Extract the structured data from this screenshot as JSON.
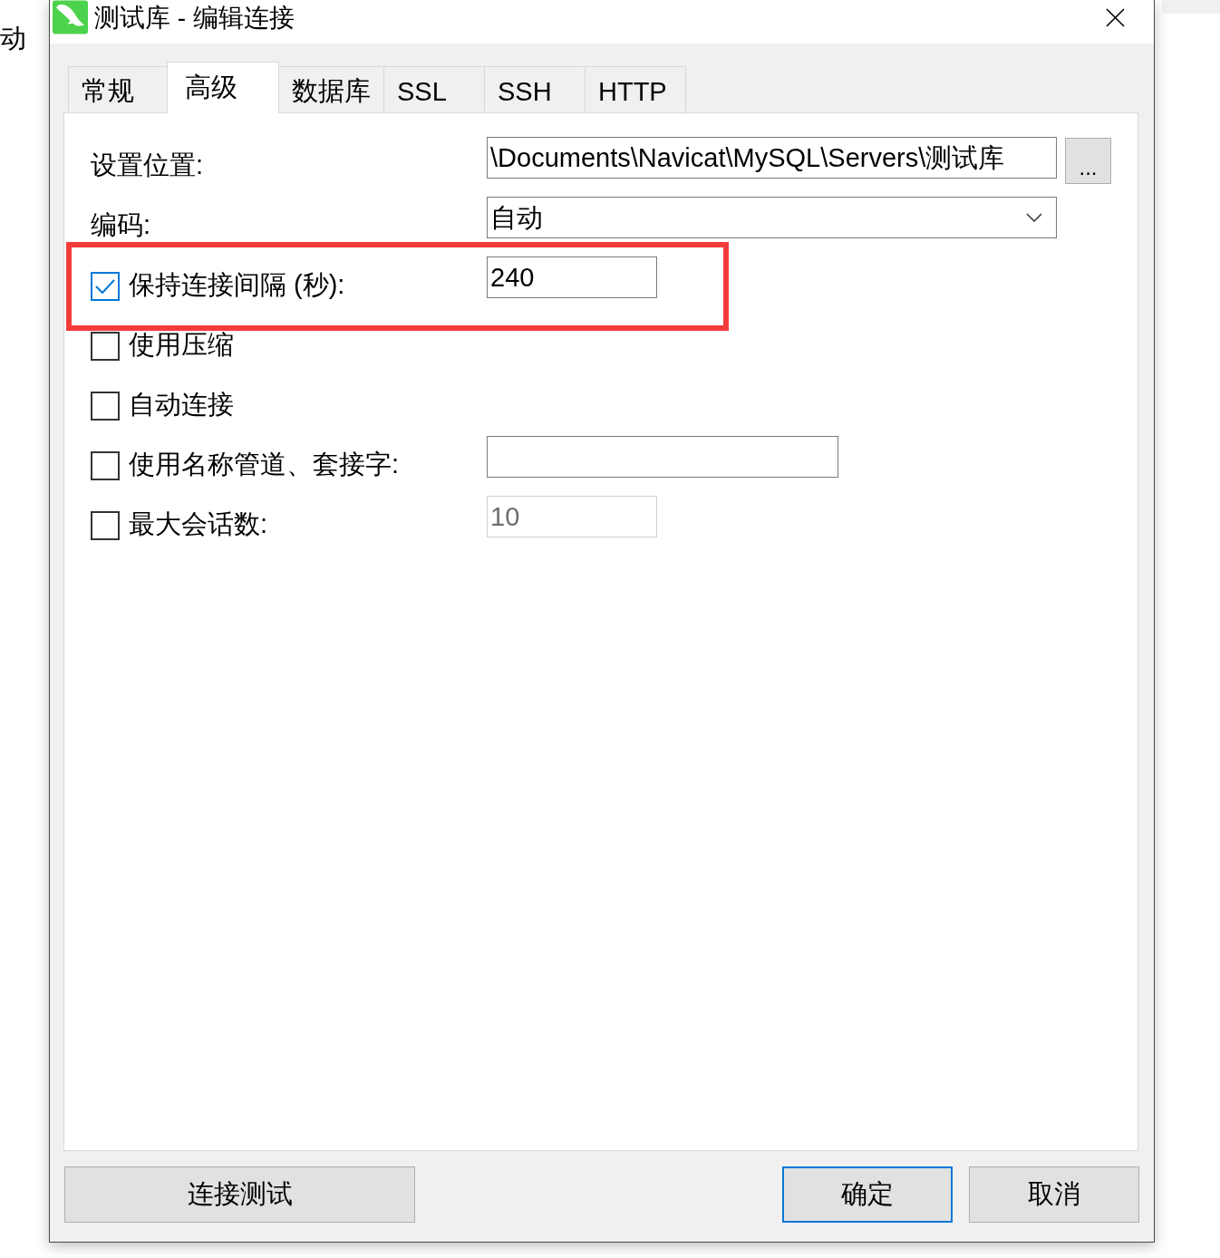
{
  "background": {
    "text": "动"
  },
  "window": {
    "title": "测试库 - 编辑连接"
  },
  "tabs": [
    {
      "label": "常规",
      "selected": false
    },
    {
      "label": "高级",
      "selected": true
    },
    {
      "label": "数据库",
      "selected": false
    },
    {
      "label": "SSL",
      "selected": false
    },
    {
      "label": "SSH",
      "selected": false
    },
    {
      "label": "HTTP",
      "selected": false
    }
  ],
  "fields": [
    {
      "kind": "path",
      "label": "设置位置:",
      "value": "\\Documents\\Navicat\\MySQL\\Servers\\测试库",
      "button": "..."
    },
    {
      "kind": "dropdown",
      "label": "编码:",
      "value": "自动"
    },
    {
      "kind": "checkbox",
      "label": "保持连接间隔 (秒):",
      "checked": true,
      "highlighted": true,
      "input": {
        "kind": "number",
        "value": "240",
        "disabled": false
      }
    },
    {
      "kind": "checkbox",
      "label": "使用压缩",
      "checked": false,
      "highlighted": false
    },
    {
      "kind": "checkbox",
      "label": "自动连接",
      "checked": false,
      "highlighted": false
    },
    {
      "kind": "checkbox",
      "label": "使用名称管道、套接字:",
      "checked": false,
      "highlighted": false,
      "input": {
        "kind": "text",
        "disabled": false
      }
    },
    {
      "kind": "checkbox",
      "label": "最大会话数:",
      "checked": false,
      "highlighted": false,
      "input": {
        "kind": "number",
        "value": "10",
        "disabled": true
      }
    }
  ],
  "buttons": [
    {
      "label": "连接测试",
      "default": false
    },
    {
      "label": "确定",
      "default": true
    },
    {
      "label": "取消",
      "default": false
    }
  ]
}
